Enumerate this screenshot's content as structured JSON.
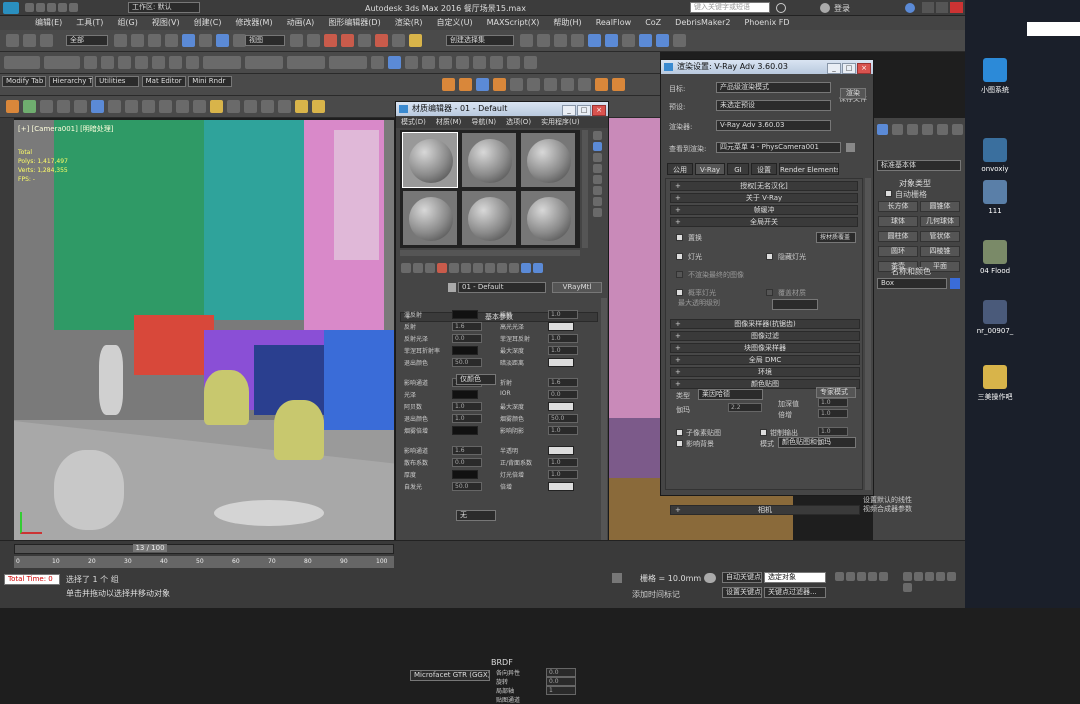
{
  "app": {
    "title": "Autodesk 3ds Max 2016    餐厅场景15.max",
    "workspace_label": "工作区: 默认",
    "search_placeholder": "键入关键字或短语",
    "login_label": "登录"
  },
  "menu": [
    "编辑(E)",
    "工具(T)",
    "组(G)",
    "视图(V)",
    "创建(C)",
    "修改器(M)",
    "动画(A)",
    "图形编辑器(D)",
    "渲染(R)",
    "自定义(U)",
    "MAXScript(X)",
    "帮助(H)",
    "RealFlow",
    "CoZ",
    "DebrisMaker2",
    "Phoenix FD"
  ],
  "toolbar": {
    "selection_filter": "全部",
    "view_combo": "视图",
    "named_selection": "创建选择集"
  },
  "tabs_row": [
    "Modify Tab",
    "Hierarchy Tab",
    "Utilities",
    "Mat Editor",
    "Mini Rndr"
  ],
  "viewport": {
    "label": "[+] [Camera001] [明暗处理]",
    "stats": [
      "Total",
      "Polys: 1,417,497",
      "Verts: 1,284,355",
      "FPS: -"
    ],
    "colors": {
      "green": "#2f9a66",
      "teal": "#2fa39b",
      "pink": "#d989c9",
      "purple": "#8a4fd6",
      "navy": "#2a3f8f",
      "blue": "#3a6cd8",
      "red": "#d8483a",
      "olive": "#c8c86e"
    }
  },
  "material_editor": {
    "title": "材质编辑器 - 01 - Default",
    "menu": [
      "模式(D)",
      "材质(M)",
      "导航(N)",
      "选项(O)",
      "实用程序(U)"
    ],
    "material_name": "01 - Default",
    "material_type": "VRayMtl",
    "section_basic": "基本参数",
    "labels": [
      "漫反射",
      "粗糙",
      "反射",
      "高光光泽",
      "反射光泽",
      "菲涅耳反射",
      "菲涅耳折射率",
      "最大深度",
      "退出颜色",
      "暗淡距离",
      "影响通道",
      "折射",
      "光泽",
      "IOR",
      "阿贝数",
      "最大深度",
      "退出颜色",
      "烟雾颜色",
      "烟雾倍增",
      "影响阴影",
      "影响通道",
      "半透明",
      "散布系数",
      "正/背面系数",
      "厚度",
      "灯光倍增",
      "自发光",
      "倍增"
    ],
    "values": [
      "0.0",
      "1.0",
      "1.6",
      "5",
      "0.0",
      "1.0",
      "0.0",
      "1.0",
      "50.0"
    ],
    "channel_combo": "仅颜色",
    "translucency_combo": "无",
    "brdf_section": "BRDF",
    "brdf_combo": "Microfacet GTR (GGX)",
    "brdf_labels": [
      "各向异性",
      "旋转",
      "局部轴",
      "贴图通道"
    ],
    "brdf_values": [
      "0.0",
      "0.0",
      "1"
    ]
  },
  "render_setup": {
    "title": "渲染设置: V-Ray Adv 3.60.03",
    "target_label": "目标:",
    "target_value": "产品级渲染模式",
    "preset_label": "预设:",
    "preset_value": "未选定预设",
    "renderer_label": "渲染器:",
    "renderer_value": "V-Ray Adv 3.60.03",
    "save_label": "保存文件",
    "view_label": "查看到渲染:",
    "view_value": "四元菜单 4 - PhysCamera001",
    "render_button": "渲染",
    "tabs": [
      "公用",
      "V-Ray",
      "GI",
      "设置",
      "Render Elements"
    ],
    "rollouts_top": [
      "授权[无名汉化]",
      "关于 V-Ray",
      "帧缓冲",
      "全局开关"
    ],
    "displacement_label": "置换",
    "displacement_mode": "按材质覆盖",
    "lights_label": "灯光",
    "hidden_lights_label": "隐藏灯光",
    "shadows_label": "不渲染最终的图像",
    "max_transp_label": "最大透明级别",
    "transp_cutoff_label": "透明中止",
    "max_ray_intens_label": "最大光线强度",
    "probabilistic_label": "概率灯光",
    "override_mtl_label": "覆盖材质",
    "rollouts_mid": [
      "图像采样器(抗锯齿)",
      "图像过滤",
      "块图像采样器",
      "全局 DMC",
      "环境",
      "颜色贴图"
    ],
    "colormap_type_label": "类型",
    "colormap_type_value": "莱因哈德",
    "colormap_mode": "专家模式",
    "gamma_label": "伽玛",
    "burn_label": "加深值",
    "multiplier_label": "倍增",
    "gamma_value": "2.2",
    "burn_value": "1.0",
    "multiplier_value": "1.0",
    "subpixel_label": "子像素贴图",
    "clamp_label": "钳制输出",
    "clamp_value": "1.0",
    "affect_bg_label": "影响背景",
    "mode_label": "模式",
    "mode_value": "颜色贴图和伽玛",
    "camera_rollout": "相机"
  },
  "right_panel": {
    "object_type_title": "对象类型",
    "autogrid_label": "自动栅格",
    "buttons": [
      "长方体",
      "圆锥体",
      "球体",
      "几何球体",
      "圆柱体",
      "管状体",
      "圆环",
      "四棱锥",
      "茶壶",
      "平面"
    ],
    "name_color_title": "名称和颜色",
    "std_primitives": "标准基本体",
    "object_name": "Box",
    "note": "设置默认的线性\n视频合成器参数"
  },
  "timeline": {
    "frame": "13 / 100",
    "ticks": [
      "0",
      "10",
      "20",
      "30",
      "40",
      "50",
      "60",
      "70",
      "80",
      "90",
      "100"
    ]
  },
  "status": {
    "selected": "选择了 1 个 组",
    "prompt": "单击并拖动以选择并移动对象",
    "script_label": "Total Time: 0",
    "grid": "栅格 = 10.0mm",
    "autokey": "自动关键点",
    "selected_combo": "选定对象",
    "setkey": "设置关键点",
    "keyfilter": "关键点过滤器...",
    "add_time_tag": "添加时间标记"
  },
  "desktop": [
    {
      "label": "小图系统",
      "color": "#2c8ad8"
    },
    {
      "label": "onvoxiy",
      "color": "#3a6f9e"
    },
    {
      "label": "111",
      "color": "#5a7fa8"
    },
    {
      "label": "04 Flood",
      "color": "#7a8a68"
    },
    {
      "label": "nr_00907_",
      "color": "#4a5a7a"
    },
    {
      "label": "三美操作吧",
      "color": "#d8b44a"
    }
  ]
}
